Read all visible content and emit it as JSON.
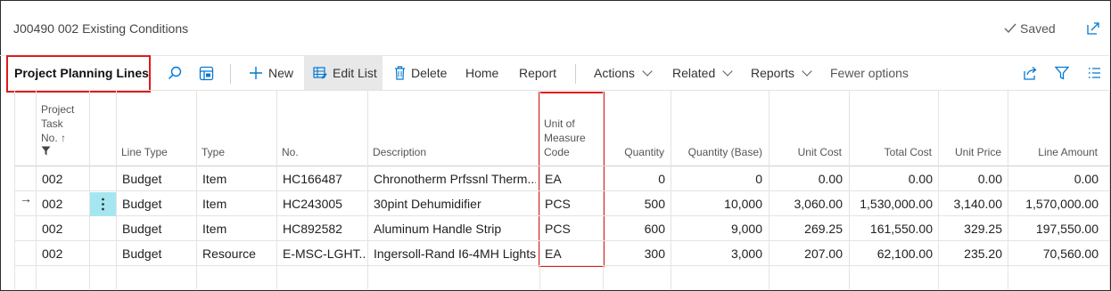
{
  "page": {
    "title": "J00490 002 Existing Conditions",
    "saved_label": "Saved"
  },
  "toolbar": {
    "title": "Project Planning Lines",
    "new_label": "New",
    "edit_list_label": "Edit List",
    "delete_label": "Delete",
    "home_label": "Home",
    "report_label": "Report",
    "actions_label": "Actions",
    "related_label": "Related",
    "reports_label": "Reports",
    "fewer_options_label": "Fewer options"
  },
  "table": {
    "headers": {
      "task_no": [
        "Project",
        "Task",
        "No. ↑"
      ],
      "line_type": "Line Type",
      "type": "Type",
      "no": "No.",
      "description": "Description",
      "uom": [
        "Unit of",
        "Measure",
        "Code"
      ],
      "quantity": "Quantity",
      "quantity_base": "Quantity (Base)",
      "unit_cost": "Unit Cost",
      "total_cost": "Total Cost",
      "unit_price": "Unit Price",
      "line_amount": "Line Amount"
    },
    "rows": [
      {
        "task_no": "002",
        "line_type": "Budget",
        "type": "Item",
        "no": "HC166487",
        "description": "Chronotherm Prfssnl Therm...",
        "uom": "EA",
        "quantity": "0",
        "quantity_base": "0",
        "unit_cost": "0.00",
        "total_cost": "0.00",
        "unit_price": "0.00",
        "line_amount": "0.00"
      },
      {
        "task_no": "002",
        "line_type": "Budget",
        "type": "Item",
        "no": "HC243005",
        "description": "30pint Dehumidifier",
        "uom": "PCS",
        "quantity": "500",
        "quantity_base": "10,000",
        "unit_cost": "3,060.00",
        "total_cost": "1,530,000.00",
        "unit_price": "3,140.00",
        "line_amount": "1,570,000.00"
      },
      {
        "task_no": "002",
        "line_type": "Budget",
        "type": "Item",
        "no": "HC892582",
        "description": "Aluminum Handle Strip",
        "uom": "PCS",
        "quantity": "600",
        "quantity_base": "9,000",
        "unit_cost": "269.25",
        "total_cost": "161,550.00",
        "unit_price": "329.25",
        "line_amount": "197,550.00"
      },
      {
        "task_no": "002",
        "line_type": "Budget",
        "type": "Resource",
        "no": "E-MSC-LGHT...",
        "description": "Ingersoll-Rand I6-4MH Lights",
        "uom": "EA",
        "quantity": "300",
        "quantity_base": "3,000",
        "unit_cost": "207.00",
        "total_cost": "62,100.00",
        "unit_price": "235.20",
        "line_amount": "70,560.00"
      }
    ]
  },
  "colors": {
    "accent": "#0078d4",
    "highlight": "#e01a1a",
    "selected_dots": "#a5e7f0"
  },
  "icons": [
    "check-icon",
    "popout-icon",
    "search-icon",
    "filter-pane-icon",
    "plus-icon",
    "edit-list-icon",
    "trash-icon",
    "share-icon",
    "funnel-icon",
    "list-icon",
    "filter-icon",
    "row-arrow-icon",
    "row-menu-icon"
  ]
}
